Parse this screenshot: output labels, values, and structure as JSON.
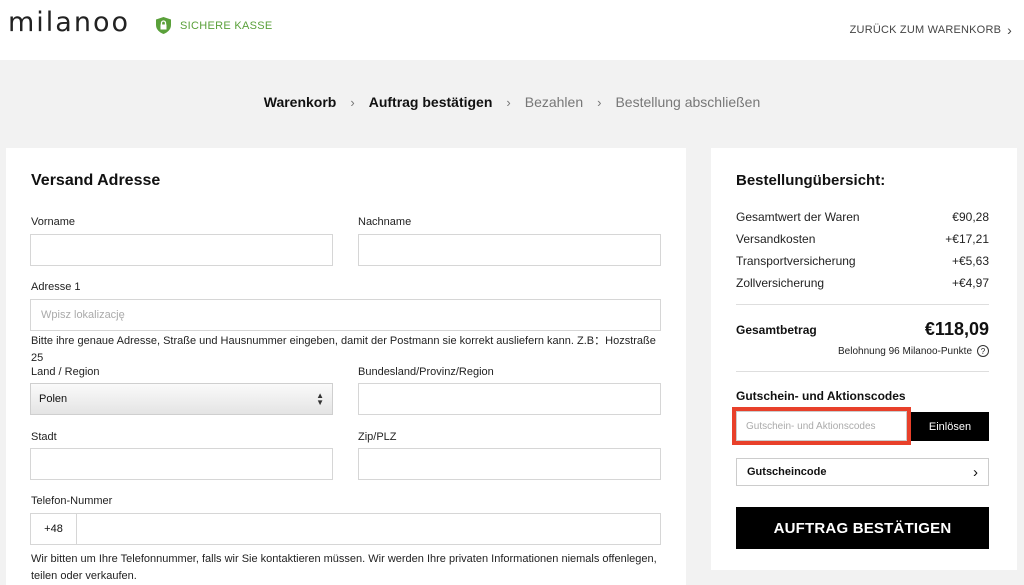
{
  "header": {
    "logo": "milanoo",
    "secure_label": "SICHERE KASSE",
    "back_link": "ZURÜCK ZUM WARENKORB",
    "back_icon": "›"
  },
  "steps": [
    {
      "label": "Warenkorb",
      "state": "done"
    },
    {
      "label": "Auftrag bestätigen",
      "state": "current"
    },
    {
      "label": "Bezahlen",
      "state": "todo"
    },
    {
      "label": "Bestellung abschließen",
      "state": "todo"
    }
  ],
  "step_separator": "›",
  "form": {
    "title": "Versand Adresse",
    "firstname_label": "Vorname",
    "lastname_label": "Nachname",
    "address_label": "Adresse 1",
    "address_placeholder": "Wpisz lokalizację",
    "address_hint": "Bitte ihre genaue Adresse, Straße und Hausnummer eingeben, damit der Postmann sie korrekt ausliefern kann. Z.B：Hozstraße 25",
    "country_label": "Land / Region",
    "country_value": "Polen",
    "state_label": "Bundesland/Provinz/Region",
    "city_label": "Stadt",
    "zip_label": "Zip/PLZ",
    "phone_label": "Telefon-Nummer",
    "phone_prefix": "+48",
    "phone_hint": "Wir bitten um Ihre Telefonnummer, falls wir Sie kontaktieren müssen. Wir werden Ihre privaten Informationen niemals offenlegen, teilen oder verkaufen."
  },
  "summary": {
    "title": "Bestellungübersicht:",
    "rows": [
      {
        "label": "Gesamtwert der Waren",
        "value": "€90,28"
      },
      {
        "label": "Versandkosten",
        "value": "+€17,21"
      },
      {
        "label": "Transportversicherung",
        "value": "+€5,63"
      },
      {
        "label": "Zollversicherung",
        "value": "+€4,97"
      }
    ],
    "total_label": "Gesamtbetrag",
    "total_value": "€118,09",
    "points_text": "Belohnung 96 Milanoo-Punkte",
    "points_help": "?",
    "coupon_title": "Gutschein- und Aktionscodes",
    "coupon_placeholder": "Gutschein- und Aktionscodes",
    "redeem_label": "Einlösen",
    "voucher_label": "Gutscheincode",
    "voucher_icon": "›",
    "confirm_label": "AUFTRAG BESTÄTIGEN"
  },
  "colors": {
    "accent_green": "#5aa03a",
    "highlight_red": "#e8402a",
    "button_black": "#000000"
  }
}
